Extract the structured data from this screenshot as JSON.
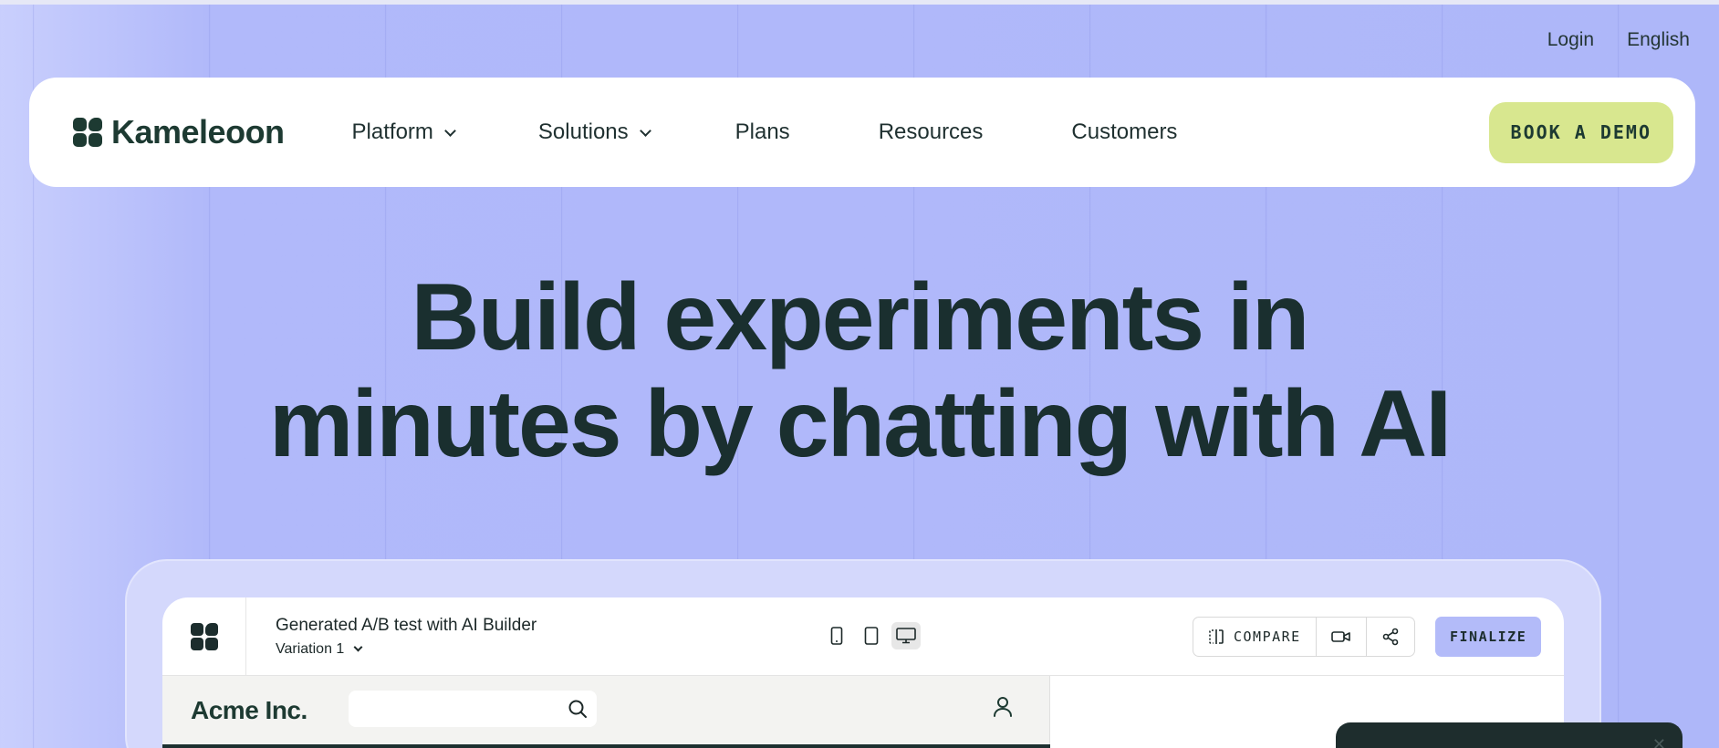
{
  "utility": {
    "login": "Login",
    "language": "English"
  },
  "brand": {
    "name": "Kameleoon"
  },
  "nav": {
    "items": [
      {
        "label": "Platform",
        "has_dropdown": true
      },
      {
        "label": "Solutions",
        "has_dropdown": true
      },
      {
        "label": "Plans",
        "has_dropdown": false
      },
      {
        "label": "Resources",
        "has_dropdown": false
      },
      {
        "label": "Customers",
        "has_dropdown": false
      }
    ],
    "cta": "BOOK A DEMO"
  },
  "hero": {
    "line1": "Build experiments in",
    "line2": "minutes by chatting with AI"
  },
  "app": {
    "test_title": "Generated A/B test with AI Builder",
    "variation": "Variation 1",
    "devices": [
      "mobile-icon",
      "tablet-icon",
      "desktop-icon"
    ],
    "active_device": "desktop",
    "compare_label": "COMPARE",
    "finalize_label": "FINALIZE",
    "site": {
      "name": "Acme Inc.",
      "search_placeholder": ""
    }
  },
  "colors": {
    "background": "#aeb7f9",
    "brand_dark": "#1d3a32",
    "cta": "#d8e78f",
    "finalize": "#b3bbf9"
  }
}
